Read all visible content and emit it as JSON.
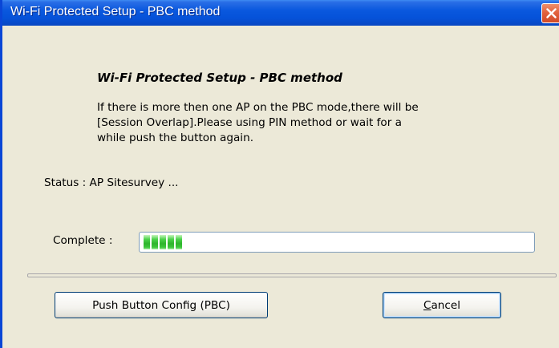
{
  "window": {
    "title": "Wi-Fi Protected Setup - PBC method"
  },
  "content": {
    "heading": "Wi-Fi Protected Setup - PBC method",
    "description_lines": [
      "If there is more then one AP on the PBC mode,there will be",
      "[Session Overlap].Please using PIN method or wait for a",
      "while push the button again."
    ],
    "status_text": "Status : AP Sitesurvey ...",
    "complete_label": "Complete :",
    "progress_segments": 5
  },
  "buttons": {
    "pbc_label": "Push Button Config (PBC)",
    "cancel_accel": "C",
    "cancel_rest": "ancel"
  },
  "colors": {
    "titlebar": "#0552d9",
    "progress_fill": "#2fb42d",
    "dialog_bg": "#ece9d8"
  },
  "icons": {
    "close": "close-icon"
  }
}
